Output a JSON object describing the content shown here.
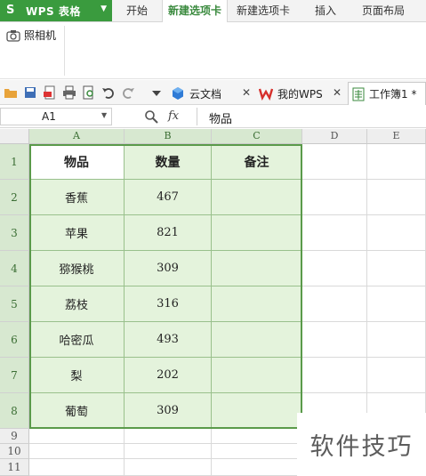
{
  "app": {
    "title": "WPS 表格",
    "logo": "S"
  },
  "ribbon_tabs": [
    "开始",
    "新建选项卡",
    "新建选项卡",
    "插入",
    "页面布局"
  ],
  "active_ribbon_tab": 1,
  "ribbon": {
    "camera_label": "照相机"
  },
  "doc_tabs": [
    {
      "label": "云文档",
      "icon": "cloud-doc-icon"
    },
    {
      "label": "我的WPS",
      "icon": "wps-logo-icon"
    },
    {
      "label": "工作簿1 *",
      "icon": "spreadsheet-icon"
    }
  ],
  "formula_bar": {
    "cell_ref": "A1",
    "fx": "fx",
    "value": "物品"
  },
  "columns": [
    "A",
    "B",
    "C",
    "D",
    "E"
  ],
  "rows": [
    "1",
    "2",
    "3",
    "4",
    "5",
    "6",
    "7",
    "8",
    "9",
    "10",
    "11"
  ],
  "table": {
    "header": [
      "物品",
      "数量",
      "备注"
    ],
    "rows": [
      [
        "香蕉",
        "467",
        ""
      ],
      [
        "苹果",
        "821",
        ""
      ],
      [
        "猕猴桃",
        "309",
        ""
      ],
      [
        "荔枝",
        "316",
        ""
      ],
      [
        "哈密瓜",
        "493",
        ""
      ],
      [
        "梨",
        "202",
        ""
      ],
      [
        "葡萄",
        "309",
        ""
      ]
    ]
  },
  "colors": {
    "accent": "#3a9b3e",
    "selection_fill": "#e4f3dc",
    "selection_border": "#5a9a4a"
  },
  "watermark": "软件技巧"
}
